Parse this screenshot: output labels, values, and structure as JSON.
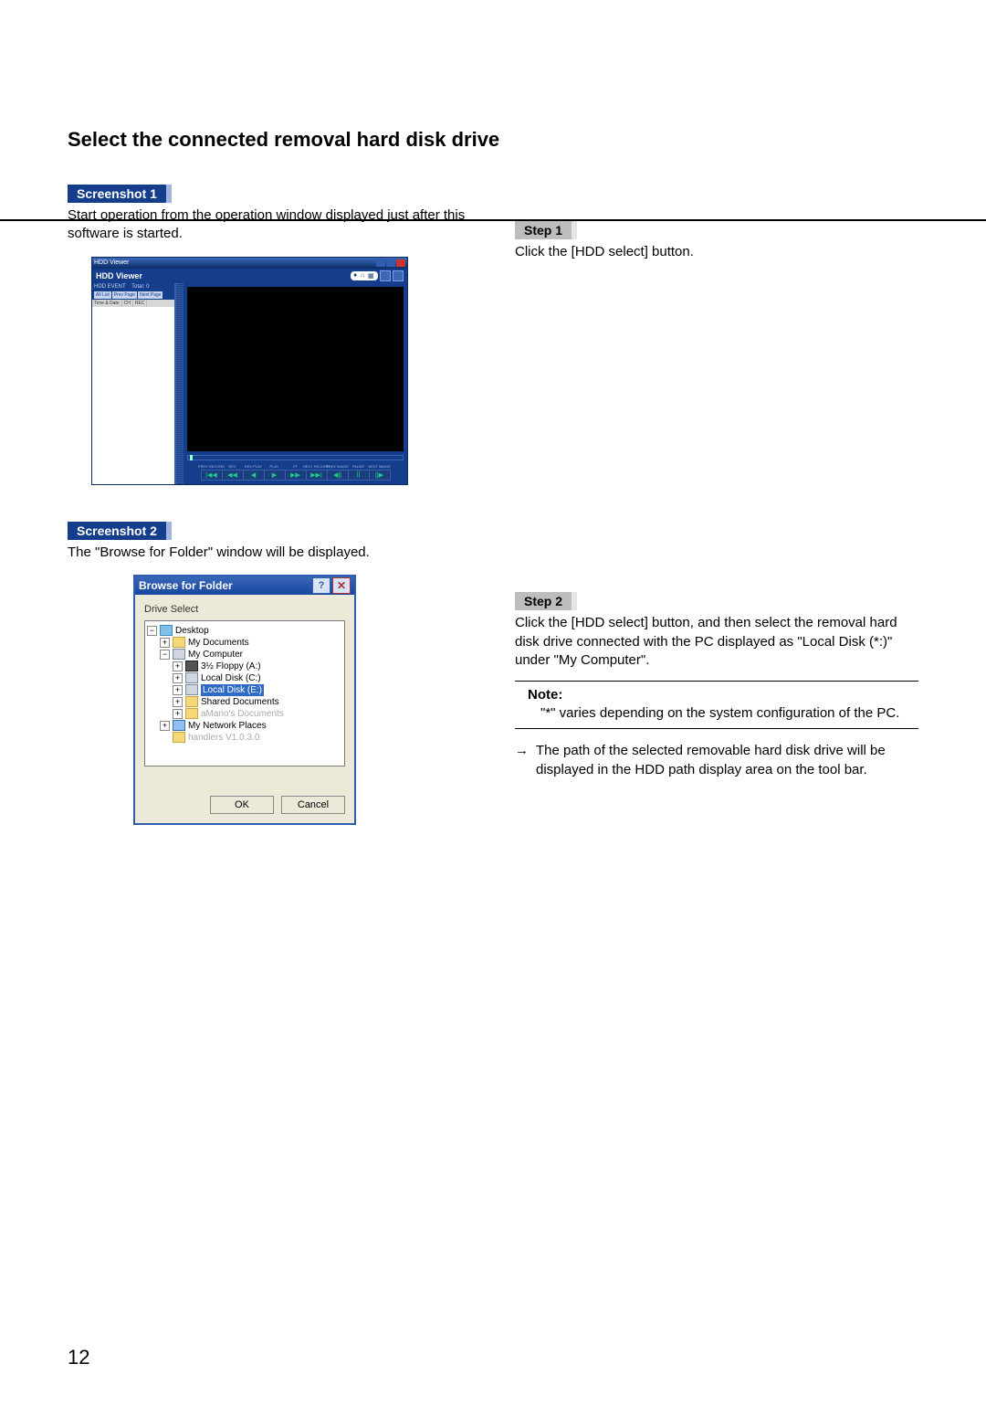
{
  "page_number": "12",
  "heading": "Select the connected removal hard disk drive",
  "screenshot1": {
    "label": "Screenshot 1",
    "text": "Start operation from the operation window displayed just after this software is started.",
    "window_title": "HDD Viewer",
    "brand": "HDD Viewer",
    "side": {
      "event_label": "HDD EVENT",
      "total_label": "Total:",
      "total_value": "0",
      "tabs": [
        "All List",
        "Prev Page",
        "Next Page"
      ],
      "cols": [
        "Time & Date",
        "CH",
        "REC"
      ]
    },
    "controls": [
      "PREV RECORD",
      "REV",
      "REV PLAY",
      "PLAY",
      "FF",
      "NEXT RECORD",
      "PREV IMAGE",
      "PAUSE",
      "NEXT IMAGE"
    ],
    "glyphs": [
      "|◀◀",
      "◀◀",
      "◀",
      "▶",
      "▶▶",
      "▶▶|",
      "◀||",
      "||",
      "||▶"
    ]
  },
  "step1": {
    "label": "Step 1",
    "text": "Click the [HDD select] button."
  },
  "screenshot2": {
    "label": "Screenshot 2",
    "text": "The \"Browse for Folder\" window will be displayed.",
    "window_title": "Browse for Folder",
    "drive_select_label": "Drive Select",
    "tree": {
      "desktop": "Desktop",
      "my_documents": "My Documents",
      "my_computer": "My Computer",
      "floppy": "3½ Floppy (A:)",
      "local_c": "Local Disk (C:)",
      "local_e": "Local Disk (E:)",
      "shared_docs": "Shared Documents",
      "user_docs": "aMario's Documents",
      "network_places": "My Network Places",
      "last_grey": "handlers V1.0.3.0"
    },
    "ok_label": "OK",
    "cancel_label": "Cancel"
  },
  "step2": {
    "label": "Step 2",
    "text": "Click the [HDD select] button, and then select the removal hard disk drive connected with the PC displayed as \"Local Disk (*:)\" under \"My Computer\".",
    "note_title": "Note:",
    "note_body": "\"*\" varies depending on the system configuration of the PC.",
    "arrow_text": "The path of the selected removable hard disk drive will be displayed in the HDD path display area on the tool bar."
  }
}
